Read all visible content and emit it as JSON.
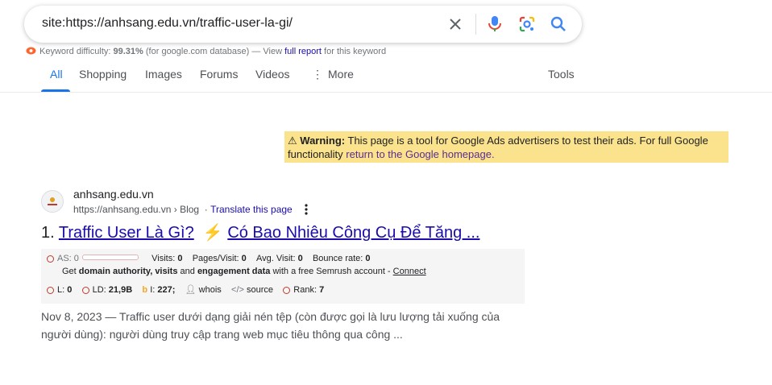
{
  "search": {
    "query": "site:https://anhsang.edu.vn/traffic-user-la-gi/"
  },
  "keyword_difficulty": {
    "label": "Keyword difficulty:",
    "value": "99.31%",
    "database": "(for google.com database) — View",
    "link": "full report",
    "suffix": "for this keyword"
  },
  "tabs": [
    "All",
    "Shopping",
    "Images",
    "Forums",
    "Videos",
    "More"
  ],
  "tools_label": "Tools",
  "warning": {
    "bold": "Warning:",
    "text": "This page is a tool for Google Ads advertisers to test their ads. For full Google functionality",
    "link": "return to the Google homepage."
  },
  "result": {
    "site_name": "anhsang.edu.vn",
    "url": "https://anhsang.edu.vn › Blog",
    "translate": "Translate this page",
    "number": "1.",
    "title_a": "Traffic User Là Gì?",
    "title_b": "Có Bao Nhiêu Công Cụ Để Tăng ...",
    "date": "Nov 8, 2023 —",
    "snippet": "Traffic user dưới dạng giải nén tệp (còn được gọi là lưu lượng tải xuống của người dùng): người dùng truy cập trang web mục tiêu thông qua công ..."
  },
  "semrush": {
    "as_label": "AS:",
    "as_value": "0",
    "visits_label": "Visits:",
    "visits_value": "0",
    "pages_label": "Pages/Visit:",
    "pages_value": "0",
    "avg_label": "Avg. Visit:",
    "avg_value": "0",
    "bounce_label": "Bounce rate:",
    "bounce_value": "0",
    "promo_a": "Get",
    "promo_b": "domain authority, visits",
    "promo_c": "and",
    "promo_d": "engagement data",
    "promo_e": "with a free Semrush account -",
    "promo_link": "Connect",
    "l_label": "L:",
    "l_value": "0",
    "ld_label": "LD:",
    "ld_value": "21,9B",
    "i_label": "I:",
    "i_value": "227;",
    "whois": "whois",
    "source": "source",
    "rank_label": "Rank:",
    "rank_value": "7"
  },
  "colors": {
    "link": "#1a0dab",
    "accent": "#1a73e8",
    "warning_bg": "#fae38c"
  }
}
